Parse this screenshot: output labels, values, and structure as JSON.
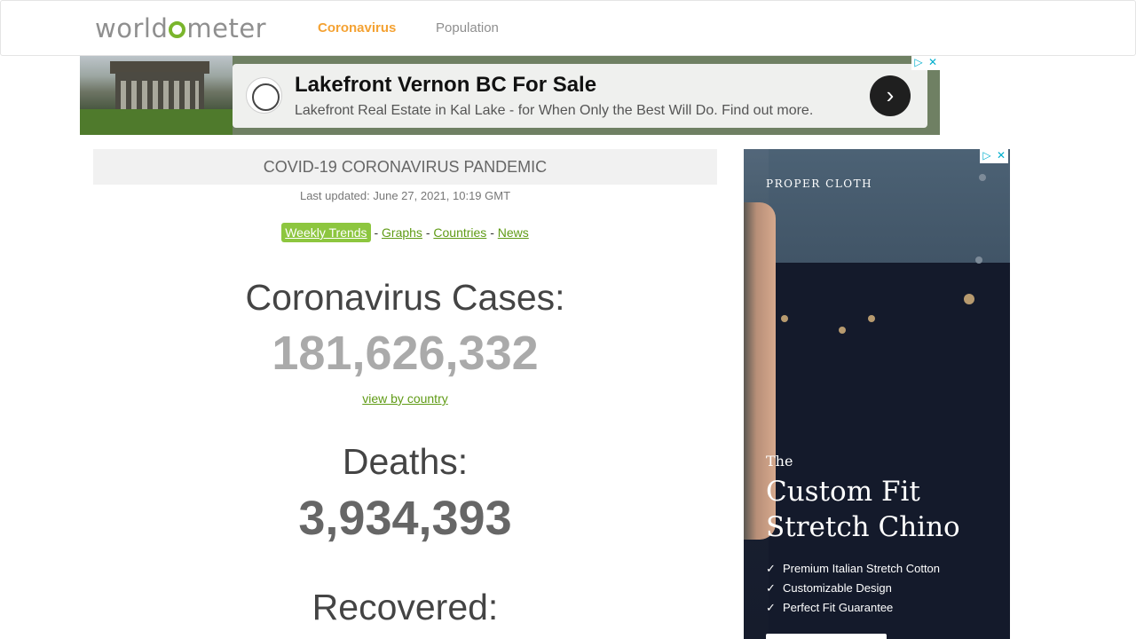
{
  "header": {
    "logo_left": "w",
    "logo_middle": "orld",
    "logo_right": "meter",
    "nav": [
      {
        "label": "Coronavirus",
        "active": true
      },
      {
        "label": "Population",
        "active": false
      }
    ]
  },
  "ad_top": {
    "title": "Lakefront Vernon BC For Sale",
    "subtitle": "Lakefront Real Estate in Kal Lake - for When Only the Best Will Do. Find out more.",
    "arrow": "›",
    "adchoices_icon": "▷",
    "close_icon": "✕"
  },
  "main": {
    "section_title": "COVID-19 CORONAVIRUS PANDEMIC",
    "last_updated": "Last updated: June 27, 2021, 10:19 GMT",
    "links": {
      "weekly": "Weekly Trends",
      "graphs": "Graphs",
      "countries": "Countries",
      "news": "News",
      "separator": "-"
    },
    "cases_label": "Coronavirus Cases:",
    "cases_value": "181,626,332",
    "view_by_country": "view by country",
    "deaths_label": "Deaths:",
    "deaths_value": "3,934,393",
    "recovered_label": "Recovered:",
    "colors": {
      "cases": "#aaaaaa",
      "deaths": "#666666",
      "link": "#609b16",
      "accent": "#8dc63f",
      "nav_active": "#f4a233"
    }
  },
  "ad_right": {
    "brand": "PROPER CLOTH",
    "the": "The",
    "headline_line1": "Custom Fit",
    "headline_line2": "Stretch Chino",
    "features": [
      "Premium Italian Stretch Cotton",
      "Customizable Design",
      "Perfect Fit Guarantee"
    ],
    "check": "✓",
    "adchoices_icon": "▷",
    "close_icon": "✕"
  }
}
